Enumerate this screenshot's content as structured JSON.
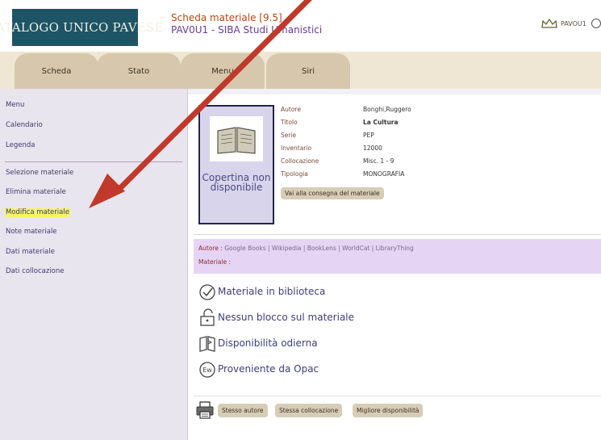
{
  "header": {
    "logo_text": "CATALOGO UNICO PAVESE",
    "title": "Scheda materiale [9.5]",
    "subtitle": "PAV0U1 - SIBA Studi Umanistici",
    "user": "PAVOU1"
  },
  "tabs": [
    "Scheda",
    "Stato",
    "Menu",
    "Siri"
  ],
  "sidebar": {
    "top_items": [
      "Menu",
      "Calendario",
      "Legenda"
    ],
    "items": [
      "Selezione materiale",
      "Elimina materiale",
      "Modifica materiale",
      "Note materiale",
      "Dati materiale",
      "Dati collocazione"
    ]
  },
  "cover": {
    "text": "Copertina non disponibile"
  },
  "meta": {
    "rows": [
      {
        "label": "Autore",
        "value": "Bonghi,Ruggero"
      },
      {
        "label": "Titolo",
        "value": "La Cultura"
      },
      {
        "label": "Serie",
        "value": "PEP"
      },
      {
        "label": "Inventario",
        "value": "12000"
      },
      {
        "label": "Collocazione",
        "value": "Misc. 1 - 9"
      },
      {
        "label": "Tipologia",
        "value": "MONOGRAFIA"
      }
    ],
    "button": "Vai alla consegna del materiale"
  },
  "links": {
    "autore_label": "Autore :",
    "autore_links": "Google Books | Wikipedia | BookLens | WorldCat | LibraryThing",
    "materiale_label": "Materiale :"
  },
  "status": [
    {
      "icon": "check-circle-icon",
      "text": "Materiale in biblioteca"
    },
    {
      "icon": "unlock-icon",
      "text": "Nessun blocco sul materiale"
    },
    {
      "icon": "book-icon",
      "text": "Disponibilità odierna"
    },
    {
      "icon": "ew-badge-icon",
      "text": "Proveniente da Opac"
    }
  ],
  "bottom_buttons": [
    "Stesso autore",
    "Stessa collocazione",
    "Migliore disponibilità"
  ],
  "colors": {
    "logo_bg": "#1e5566",
    "tab_bg": "#d7c8ad",
    "sidebar_bg": "#e9e5ee",
    "links_bg": "#e6d4f4",
    "highlight": "#f6f36a",
    "arrow": "#c0392b"
  }
}
